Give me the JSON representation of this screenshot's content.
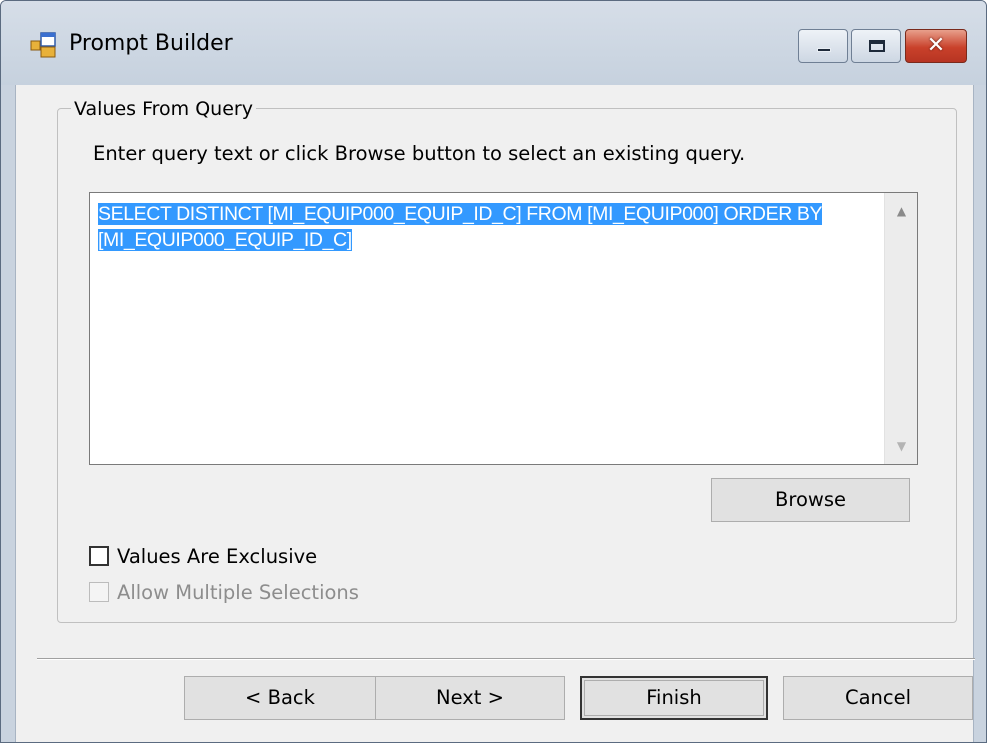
{
  "window": {
    "title": "Prompt Builder",
    "icon": "app-window-icon",
    "controls": [
      "minimize-icon",
      "maximize-icon",
      "close-icon"
    ],
    "close_glyph": "✕",
    "colors": {
      "titlebar": "#c9d3df",
      "close_button": "#c9412b",
      "selection": "#3399ff"
    }
  },
  "group": {
    "legend": "Values From Query",
    "instruction": "Enter query text or click Browse button to select an existing query.",
    "query_text": "SELECT DISTINCT [MI_EQUIP000_EQUIP_ID_C] FROM [MI_EQUIP000] ORDER BY [MI_EQUIP000_EQUIP_ID_C]",
    "query_selected": true,
    "browse_label": "Browse",
    "scroll_up": "▲",
    "scroll_down": "▼"
  },
  "options": {
    "values_exclusive": {
      "label": "Values Are Exclusive",
      "checked": false,
      "enabled": true
    },
    "allow_multiple": {
      "label": "Allow Multiple Selections",
      "checked": false,
      "enabled": false
    }
  },
  "footer": {
    "back_label": "< Back",
    "next_label": "Next >",
    "finish_label": "Finish",
    "cancel_label": "Cancel"
  }
}
